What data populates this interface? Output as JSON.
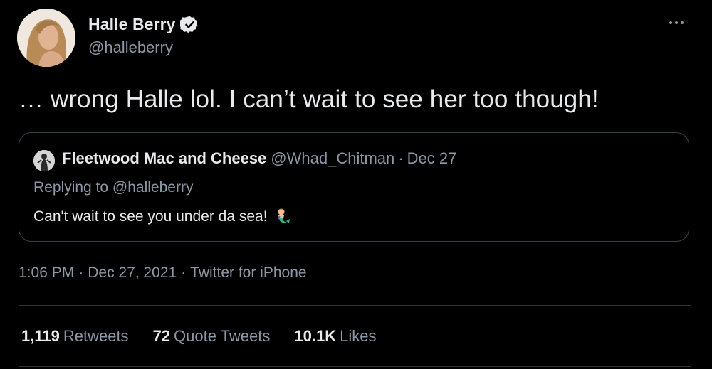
{
  "author": {
    "display_name": "Halle Berry",
    "handle": "@halleberry",
    "verified_icon": "verified-badge-icon"
  },
  "tweet": {
    "text": "… wrong Halle lol. I can’t wait to see her too though!",
    "time": "1:06 PM",
    "date": "Dec 27, 2021",
    "source": "Twitter for iPhone",
    "separator": "·"
  },
  "quoted_tweet": {
    "display_name": "Fleetwood Mac and Cheese",
    "handle": "@Whad_Chitman",
    "separator": "·",
    "date": "Dec 27",
    "replying_prefix": "Replying to",
    "replying_to": "@halleberry",
    "text": "Can't wait to see you under da sea!",
    "emoji_icon": "mermaid-emoji-icon"
  },
  "stats": {
    "retweets_count": "1,119",
    "retweets_label": "Retweets",
    "quotes_count": "72",
    "quotes_label": "Quote Tweets",
    "likes_count": "10.1K",
    "likes_label": "Likes"
  },
  "colors": {
    "background": "#000000",
    "primary_text": "#e7e9ea",
    "secondary_text": "#8b98a5",
    "border": "#2f3336"
  }
}
